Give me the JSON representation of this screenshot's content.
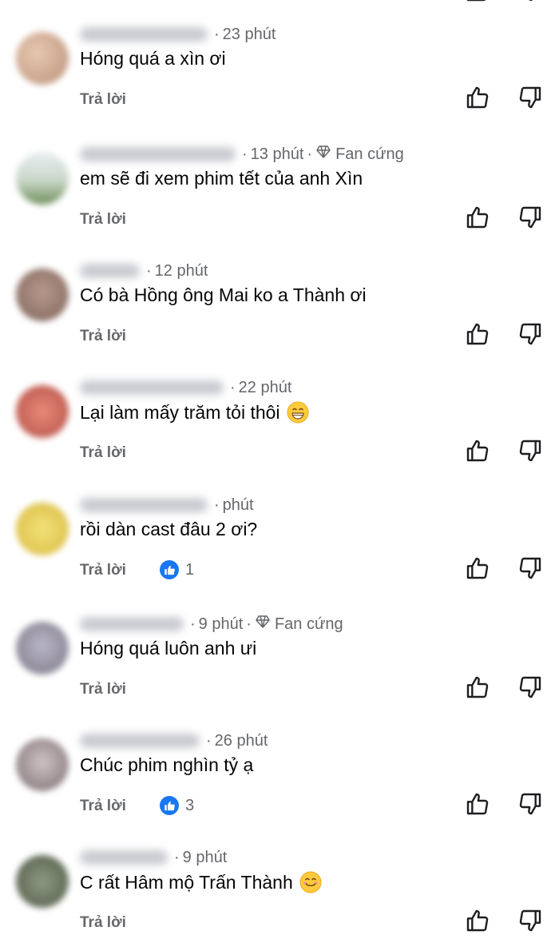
{
  "ui": {
    "reply_label": "Trả lời",
    "fan_label": "Fan cứng"
  },
  "comments": [
    {
      "time": "23 phút",
      "text": "Hóng quá a xìn ơi",
      "fan": false,
      "likes": "",
      "emoji": ""
    },
    {
      "time": "13 phút",
      "text": "em sẽ đi xem phim tết của anh Xìn",
      "fan": true,
      "likes": "",
      "emoji": ""
    },
    {
      "time": "12 phút",
      "text": "Có bà Hồng ông Mai ko a Thành ơi",
      "fan": false,
      "likes": "",
      "emoji": ""
    },
    {
      "time": "22 phút",
      "text": "Lại làm mấy trăm tỏi thôi",
      "fan": false,
      "likes": "",
      "emoji": "grinning"
    },
    {
      "time": "phút",
      "text": "rồi dàn cast đâu 2 ơi?",
      "fan": false,
      "likes": "1",
      "emoji": ""
    },
    {
      "time": "9 phút",
      "text": "Hóng quá luôn anh ưi",
      "fan": true,
      "likes": "",
      "emoji": ""
    },
    {
      "time": "26 phút",
      "text": "Chúc phim nghìn tỷ ạ",
      "fan": false,
      "likes": "3",
      "emoji": ""
    },
    {
      "time": "9 phút",
      "text": "C rất Hâm mộ Trấn Thành",
      "fan": false,
      "likes": "",
      "emoji": "smiling"
    }
  ],
  "colors": {
    "meta": "#65676b",
    "text": "#050505",
    "like_blue": "#1877f2"
  }
}
